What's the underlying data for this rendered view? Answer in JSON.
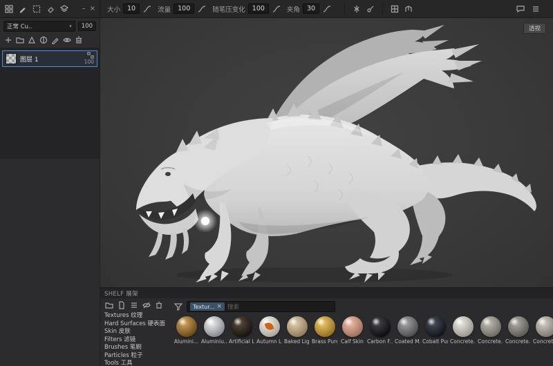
{
  "window": {
    "minimize": "–",
    "close": "×"
  },
  "toolbar": {
    "params": [
      {
        "label": "大小",
        "value": "10"
      },
      {
        "label": "流量",
        "value": "100"
      },
      {
        "label": "随笔压变化",
        "value": "100"
      },
      {
        "label": "夹角",
        "value": "30"
      }
    ]
  },
  "left_panel": {
    "blend_mode": "正常 Cu..",
    "blend_chevron": "▾",
    "opacity": "100",
    "layers": [
      {
        "name": "图层 1",
        "opacity": "100"
      }
    ]
  },
  "viewport": {
    "camera_button": "透视"
  },
  "shelf": {
    "title": "SHELF 展架",
    "categories": [
      {
        "en": "Textures",
        "zh": "纹理"
      },
      {
        "en": "Hard Surfaces",
        "zh": "硬表面"
      },
      {
        "en": "Skin",
        "zh": "皮肤"
      },
      {
        "en": "Filters",
        "zh": "滤镜"
      },
      {
        "en": "Brushes",
        "zh": "笔刷"
      },
      {
        "en": "Particles",
        "zh": "粒子"
      },
      {
        "en": "Tools",
        "zh": "工具"
      }
    ],
    "search": {
      "tag": "Textur...",
      "tag_close": "×",
      "placeholder": "搜索"
    },
    "materials": [
      {
        "name": "Alumini...",
        "c1": "#d8a85f",
        "c2": "#5f4116"
      },
      {
        "name": "Aluminiu...",
        "c1": "#f0f0f2",
        "c2": "#7e8288"
      },
      {
        "name": "Artificial L...",
        "c1": "#5a4c3e",
        "c2": "#14100c"
      },
      {
        "name": "Autumn L...",
        "c1": "#f4f1ea",
        "c2": "#a8a094",
        "accent": "#c9651c"
      },
      {
        "name": "Baked Lig...",
        "c1": "#e2d0b0",
        "c2": "#8a7656"
      },
      {
        "name": "Brass Pure",
        "c1": "#f0cb70",
        "c2": "#8d681c"
      },
      {
        "name": "Calf Skin",
        "c1": "#ecc0aa",
        "c2": "#9c6a58"
      },
      {
        "name": "Carbon F...",
        "c1": "#46464c",
        "c2": "#0a0a0c"
      },
      {
        "name": "Coated M...",
        "c1": "#a8a8aa",
        "c2": "#47474b"
      },
      {
        "name": "Cobalt Pure",
        "c1": "#49505e",
        "c2": "#0d1016"
      },
      {
        "name": "Concrete...",
        "c1": "#eceae4",
        "c2": "#94918a"
      },
      {
        "name": "Concrete...",
        "c1": "#c2bfb7",
        "c2": "#67645c"
      },
      {
        "name": "Concrete...",
        "c1": "#b1aea8",
        "c2": "#57544e"
      },
      {
        "name": "Concrete...",
        "c1": "#d4d1c9",
        "c2": "#787168"
      }
    ]
  }
}
